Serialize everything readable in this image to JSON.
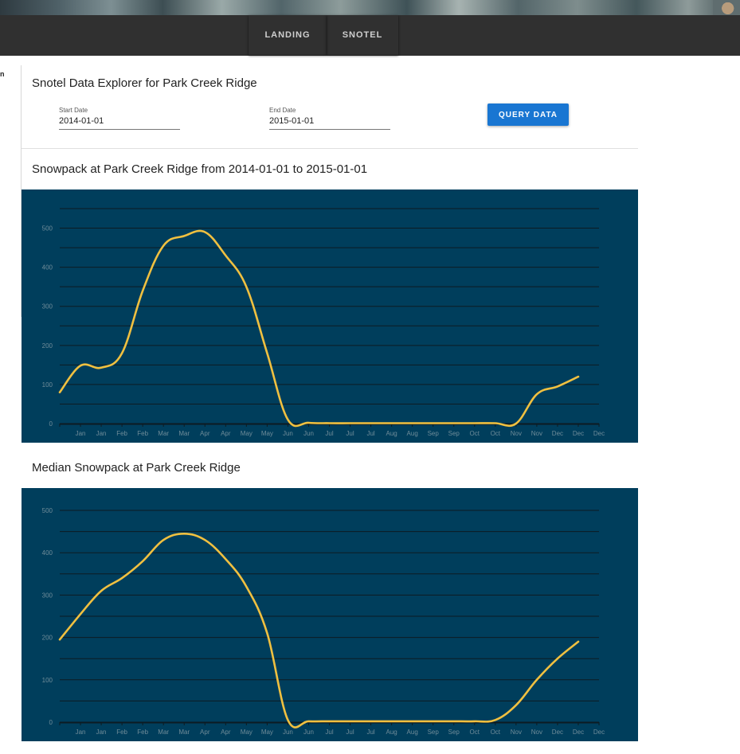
{
  "nav": {
    "tabs": [
      {
        "label": "LANDING"
      },
      {
        "label": "SNOTEL"
      }
    ]
  },
  "left_stub_text": "n",
  "explorer": {
    "title": "Snotel Data Explorer for Park Creek Ridge",
    "start_date": {
      "label": "Start Date",
      "value": "2014-01-01"
    },
    "end_date": {
      "label": "End Date",
      "value": "2015-01-01"
    },
    "query_label": "QUERY DATA"
  },
  "colors": {
    "navbar": "#303030",
    "chart_bg": "#003e5c",
    "line": "#f0c040",
    "button": "#1976d2"
  },
  "chart_data": [
    {
      "type": "line",
      "title": "Snowpack at Park Creek Ridge from 2014-01-01 to 2015-01-01",
      "ylim": [
        0,
        550
      ],
      "yticks": [
        0,
        100,
        200,
        300,
        400,
        500
      ],
      "xticks": [
        "Jan",
        "Jan",
        "Feb",
        "Feb",
        "Mar",
        "Mar",
        "Apr",
        "Apr",
        "May",
        "May",
        "Jun",
        "Jun",
        "Jul",
        "Jul",
        "Jul",
        "Aug",
        "Aug",
        "Sep",
        "Sep",
        "Oct",
        "Oct",
        "Nov",
        "Nov",
        "Dec",
        "Dec",
        "Dec"
      ],
      "grid": true,
      "series": [
        {
          "x": [
            0,
            1,
            2,
            3,
            4,
            5,
            6,
            7,
            8,
            9,
            10,
            11,
            12,
            13,
            14,
            15,
            16,
            17,
            18,
            19,
            20,
            21,
            22,
            23,
            24,
            25,
            26
          ],
          "values": [
            80,
            148,
            143,
            180,
            340,
            455,
            480,
            490,
            430,
            350,
            180,
            10,
            2,
            1,
            1,
            1,
            1,
            1,
            1,
            1,
            1,
            1,
            0,
            75,
            95,
            120,
            120
          ]
        }
      ]
    },
    {
      "type": "line",
      "title": "Median Snowpack at Park Creek Ridge",
      "ylim": [
        0,
        500
      ],
      "yticks": [
        0,
        100,
        200,
        300,
        400,
        500
      ],
      "xticks": [
        "Jan",
        "Jan",
        "Feb",
        "Feb",
        "Mar",
        "Mar",
        "Apr",
        "Apr",
        "May",
        "May",
        "Jun",
        "Jun",
        "Jul",
        "Jul",
        "Jul",
        "Aug",
        "Aug",
        "Sep",
        "Sep",
        "Oct",
        "Oct",
        "Nov",
        "Nov",
        "Dec",
        "Dec",
        "Dec"
      ],
      "grid": true,
      "series": [
        {
          "x": [
            0,
            1,
            2,
            3,
            4,
            5,
            6,
            7,
            8,
            9,
            10,
            11,
            12,
            13,
            14,
            15,
            16,
            17,
            18,
            19,
            20,
            21,
            22,
            23,
            24,
            25,
            26
          ],
          "values": [
            195,
            255,
            310,
            340,
            380,
            430,
            445,
            430,
            385,
            320,
            210,
            5,
            2,
            2,
            2,
            2,
            2,
            2,
            2,
            2,
            2,
            5,
            40,
            100,
            150,
            190,
            190
          ]
        }
      ]
    }
  ]
}
